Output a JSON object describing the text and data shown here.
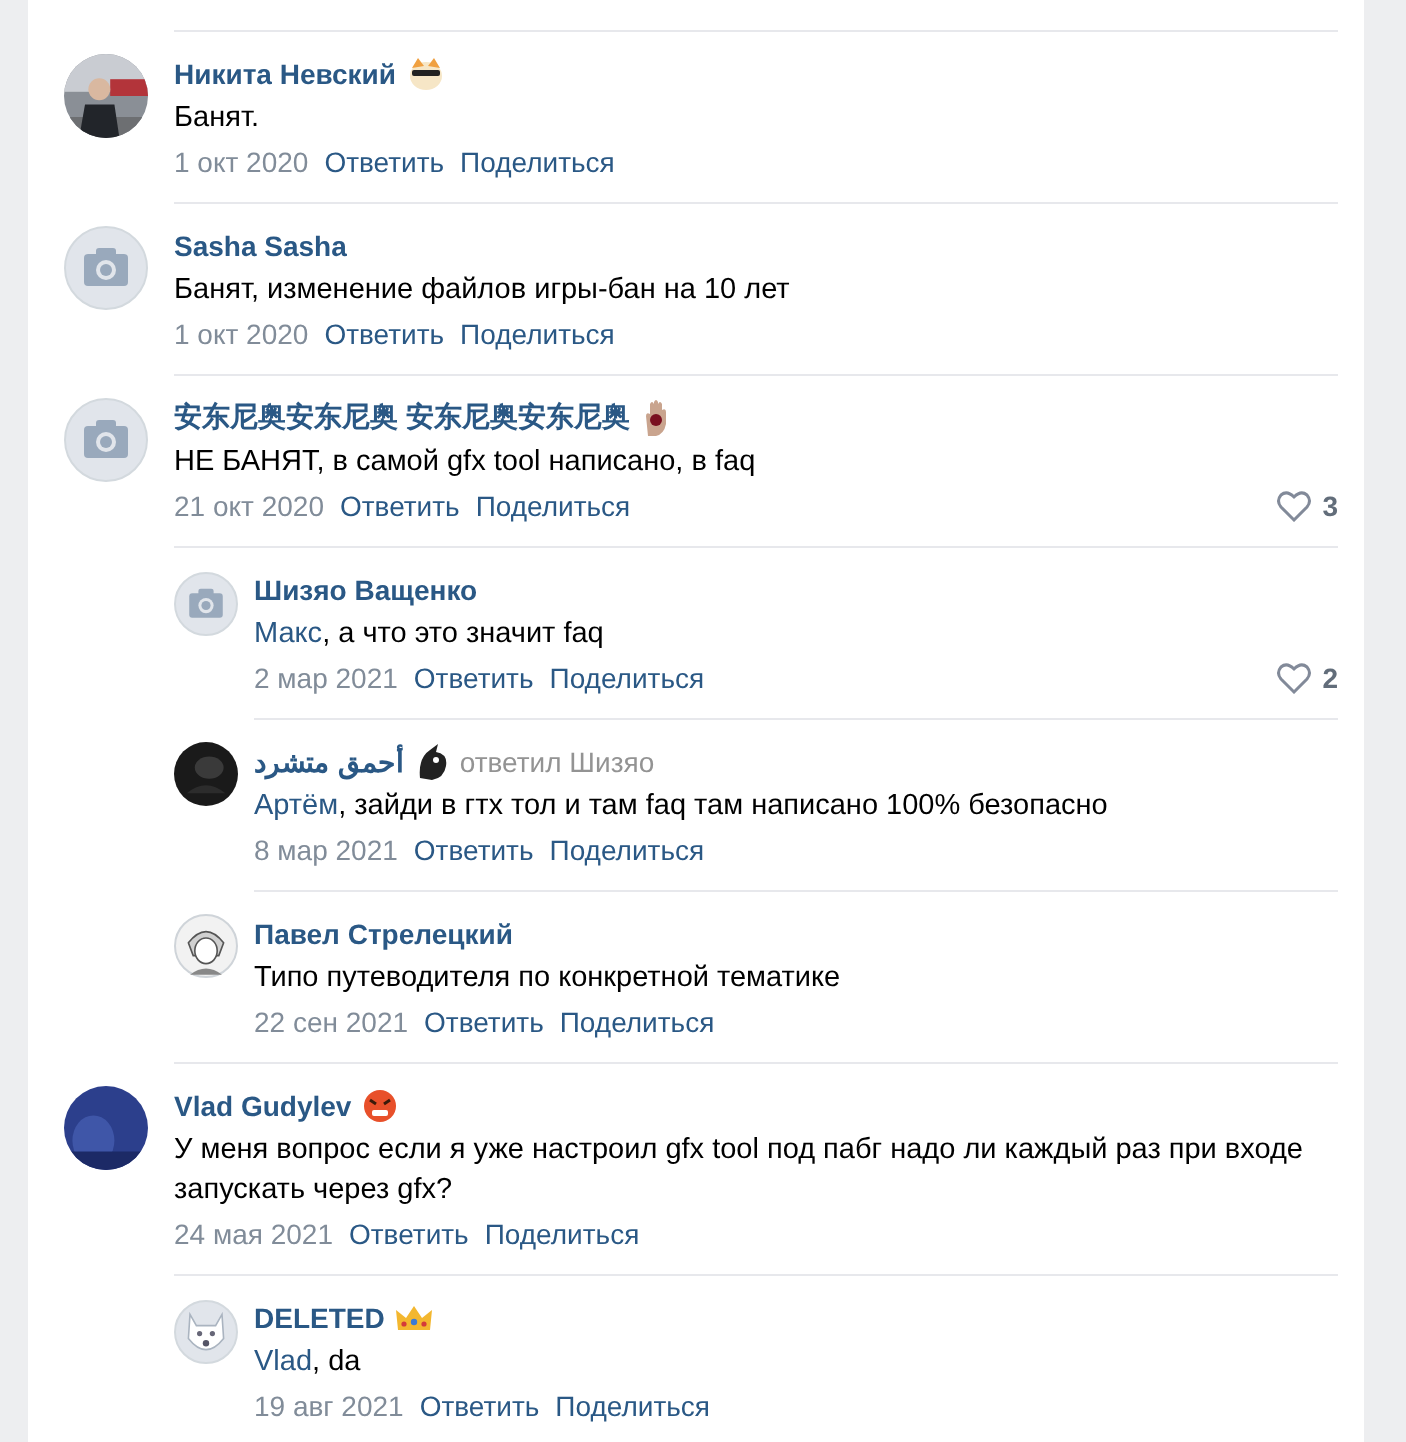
{
  "comments": [
    {
      "author": "Никита Невский",
      "badge": {
        "kind": "shades"
      },
      "text": "Банят.",
      "date": "1 окт 2020",
      "reply_link": "Ответить",
      "share_link": "Поделиться"
    },
    {
      "author": "Sasha Sasha",
      "avatar": {
        "kind": "camera"
      },
      "text": "Банят, изменение файлов игры-бан на 10 лет",
      "date": "1 окт 2020",
      "reply_link": "Ответить",
      "share_link": "Поделиться"
    },
    {
      "author": "安东尼奥安东尼奥 安东尼奥安东尼奥",
      "badge": {
        "kind": "hand"
      },
      "avatar": {
        "kind": "camera"
      },
      "text": "НЕ БАНЯТ, в самой gfx tool написано, в faq",
      "date": "21 окт 2020",
      "reply_link": "Ответить",
      "share_link": "Поделиться",
      "likes": "3",
      "replies": [
        {
          "author": "Шизяо Ващенко",
          "avatar": {
            "kind": "camera"
          },
          "addressee": "Макс",
          "text": ", а что это значит faq",
          "date": "2 мар 2021",
          "reply_link": "Ответить",
          "share_link": "Поделиться",
          "likes": "2"
        },
        {
          "author": "أحمق متشرد",
          "badge": {
            "kind": "bird"
          },
          "avatar": {
            "kind": "dark"
          },
          "replied_to": "ответил Шизяо",
          "addressee": "Артём",
          "text": ", зайди в гтх тол и там faq там написано 100% безопасно",
          "date": "8 мар 2021",
          "reply_link": "Ответить",
          "share_link": "Поделиться"
        },
        {
          "author": "Павел Стрелецкий",
          "avatar": {
            "kind": "sketch"
          },
          "text": "Типо путеводителя по конкретной тематике",
          "date": "22 сен 2021",
          "reply_link": "Ответить",
          "share_link": "Поделиться"
        }
      ]
    },
    {
      "author": "Vlad Gudylev",
      "badge": {
        "kind": "angry"
      },
      "avatar": {
        "kind": "blue"
      },
      "text": "У меня вопрос если я уже настроил gfx tool под пабг надо ли каждый раз при входе запускать через gfx?",
      "date": "24 мая 2021",
      "reply_link": "Ответить",
      "share_link": "Поделиться",
      "replies": [
        {
          "author": "DELETED",
          "badge": {
            "kind": "crown"
          },
          "avatar": {
            "kind": "deleted"
          },
          "addressee": "Vlad",
          "text": ", da",
          "date": "19 авг 2021",
          "reply_link": "Ответить",
          "share_link": "Поделиться"
        }
      ]
    }
  ]
}
